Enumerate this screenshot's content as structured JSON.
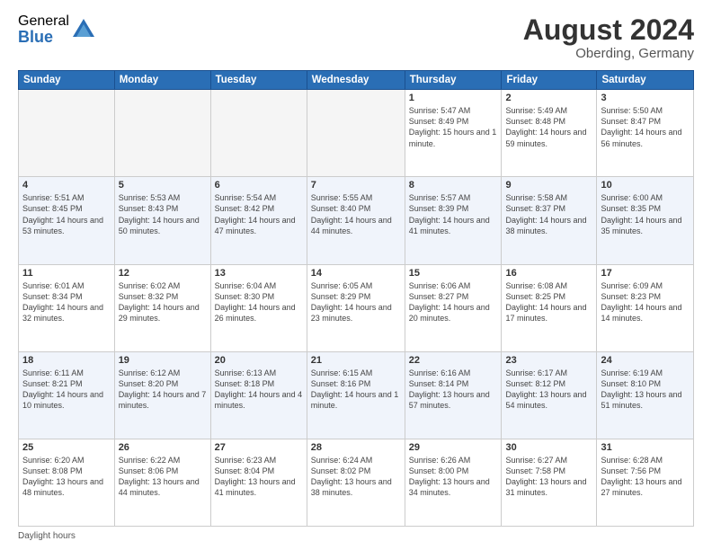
{
  "logo": {
    "general": "General",
    "blue": "Blue"
  },
  "title": {
    "month_year": "August 2024",
    "location": "Oberding, Germany"
  },
  "headers": [
    "Sunday",
    "Monday",
    "Tuesday",
    "Wednesday",
    "Thursday",
    "Friday",
    "Saturday"
  ],
  "weeks": [
    [
      {
        "day": "",
        "info": ""
      },
      {
        "day": "",
        "info": ""
      },
      {
        "day": "",
        "info": ""
      },
      {
        "day": "",
        "info": ""
      },
      {
        "day": "1",
        "info": "Sunrise: 5:47 AM\nSunset: 8:49 PM\nDaylight: 15 hours\nand 1 minute."
      },
      {
        "day": "2",
        "info": "Sunrise: 5:49 AM\nSunset: 8:48 PM\nDaylight: 14 hours\nand 59 minutes."
      },
      {
        "day": "3",
        "info": "Sunrise: 5:50 AM\nSunset: 8:47 PM\nDaylight: 14 hours\nand 56 minutes."
      }
    ],
    [
      {
        "day": "4",
        "info": "Sunrise: 5:51 AM\nSunset: 8:45 PM\nDaylight: 14 hours\nand 53 minutes."
      },
      {
        "day": "5",
        "info": "Sunrise: 5:53 AM\nSunset: 8:43 PM\nDaylight: 14 hours\nand 50 minutes."
      },
      {
        "day": "6",
        "info": "Sunrise: 5:54 AM\nSunset: 8:42 PM\nDaylight: 14 hours\nand 47 minutes."
      },
      {
        "day": "7",
        "info": "Sunrise: 5:55 AM\nSunset: 8:40 PM\nDaylight: 14 hours\nand 44 minutes."
      },
      {
        "day": "8",
        "info": "Sunrise: 5:57 AM\nSunset: 8:39 PM\nDaylight: 14 hours\nand 41 minutes."
      },
      {
        "day": "9",
        "info": "Sunrise: 5:58 AM\nSunset: 8:37 PM\nDaylight: 14 hours\nand 38 minutes."
      },
      {
        "day": "10",
        "info": "Sunrise: 6:00 AM\nSunset: 8:35 PM\nDaylight: 14 hours\nand 35 minutes."
      }
    ],
    [
      {
        "day": "11",
        "info": "Sunrise: 6:01 AM\nSunset: 8:34 PM\nDaylight: 14 hours\nand 32 minutes."
      },
      {
        "day": "12",
        "info": "Sunrise: 6:02 AM\nSunset: 8:32 PM\nDaylight: 14 hours\nand 29 minutes."
      },
      {
        "day": "13",
        "info": "Sunrise: 6:04 AM\nSunset: 8:30 PM\nDaylight: 14 hours\nand 26 minutes."
      },
      {
        "day": "14",
        "info": "Sunrise: 6:05 AM\nSunset: 8:29 PM\nDaylight: 14 hours\nand 23 minutes."
      },
      {
        "day": "15",
        "info": "Sunrise: 6:06 AM\nSunset: 8:27 PM\nDaylight: 14 hours\nand 20 minutes."
      },
      {
        "day": "16",
        "info": "Sunrise: 6:08 AM\nSunset: 8:25 PM\nDaylight: 14 hours\nand 17 minutes."
      },
      {
        "day": "17",
        "info": "Sunrise: 6:09 AM\nSunset: 8:23 PM\nDaylight: 14 hours\nand 14 minutes."
      }
    ],
    [
      {
        "day": "18",
        "info": "Sunrise: 6:11 AM\nSunset: 8:21 PM\nDaylight: 14 hours\nand 10 minutes."
      },
      {
        "day": "19",
        "info": "Sunrise: 6:12 AM\nSunset: 8:20 PM\nDaylight: 14 hours\nand 7 minutes."
      },
      {
        "day": "20",
        "info": "Sunrise: 6:13 AM\nSunset: 8:18 PM\nDaylight: 14 hours\nand 4 minutes."
      },
      {
        "day": "21",
        "info": "Sunrise: 6:15 AM\nSunset: 8:16 PM\nDaylight: 14 hours\nand 1 minute."
      },
      {
        "day": "22",
        "info": "Sunrise: 6:16 AM\nSunset: 8:14 PM\nDaylight: 13 hours\nand 57 minutes."
      },
      {
        "day": "23",
        "info": "Sunrise: 6:17 AM\nSunset: 8:12 PM\nDaylight: 13 hours\nand 54 minutes."
      },
      {
        "day": "24",
        "info": "Sunrise: 6:19 AM\nSunset: 8:10 PM\nDaylight: 13 hours\nand 51 minutes."
      }
    ],
    [
      {
        "day": "25",
        "info": "Sunrise: 6:20 AM\nSunset: 8:08 PM\nDaylight: 13 hours\nand 48 minutes."
      },
      {
        "day": "26",
        "info": "Sunrise: 6:22 AM\nSunset: 8:06 PM\nDaylight: 13 hours\nand 44 minutes."
      },
      {
        "day": "27",
        "info": "Sunrise: 6:23 AM\nSunset: 8:04 PM\nDaylight: 13 hours\nand 41 minutes."
      },
      {
        "day": "28",
        "info": "Sunrise: 6:24 AM\nSunset: 8:02 PM\nDaylight: 13 hours\nand 38 minutes."
      },
      {
        "day": "29",
        "info": "Sunrise: 6:26 AM\nSunset: 8:00 PM\nDaylight: 13 hours\nand 34 minutes."
      },
      {
        "day": "30",
        "info": "Sunrise: 6:27 AM\nSunset: 7:58 PM\nDaylight: 13 hours\nand 31 minutes."
      },
      {
        "day": "31",
        "info": "Sunrise: 6:28 AM\nSunset: 7:56 PM\nDaylight: 13 hours\nand 27 minutes."
      }
    ]
  ],
  "footer": "Daylight hours"
}
